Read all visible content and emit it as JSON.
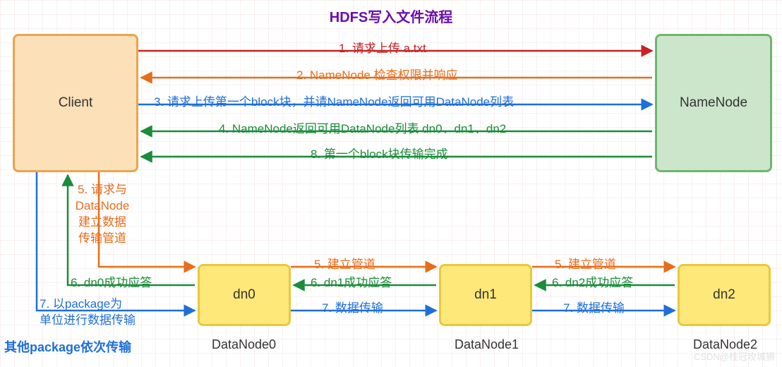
{
  "title": "HDFS写入文件流程",
  "boxes": {
    "client": "Client",
    "namenode": "NameNode",
    "dn0": "dn0",
    "dn1": "dn1",
    "dn2": "dn2"
  },
  "dnLabels": {
    "dn0": "DataNode0",
    "dn1": "DataNode1",
    "dn2": "DataNode2"
  },
  "pkgLabel": "其他package依次传输",
  "arrows": {
    "a1": "1. 请求上传 a.txt",
    "a2": "2. NameNode 检查权限并响应",
    "a3": "3. 请求上传第一个block块，并请NameNode返回可用DataNode列表",
    "a4": "4. NameNode返回可用DataNode列表 dn0、dn1、dn2",
    "a8": "8. 第一个block块传输完成",
    "a5v": "5. 请求与\nDataNode\n建立数据\n传输管道",
    "a5h1": "5. 建立管道",
    "a5h2": "5. 建立管道",
    "a6v": "6. dn0成功应答",
    "a6h1": "6. dn1成功应答",
    "a6h2": "6. dn2成功应答",
    "a7v": "7. 以package为\n单位进行数据传输",
    "a7h1": "7. 数据传输",
    "a7h2": "7. 数据传输"
  },
  "colors": {
    "red": "#c62222",
    "orange": "#e86c1a",
    "blue": "#1e6fd9",
    "green": "#1a8c3a"
  },
  "watermark": "CSDN@桂冠攻城狮"
}
